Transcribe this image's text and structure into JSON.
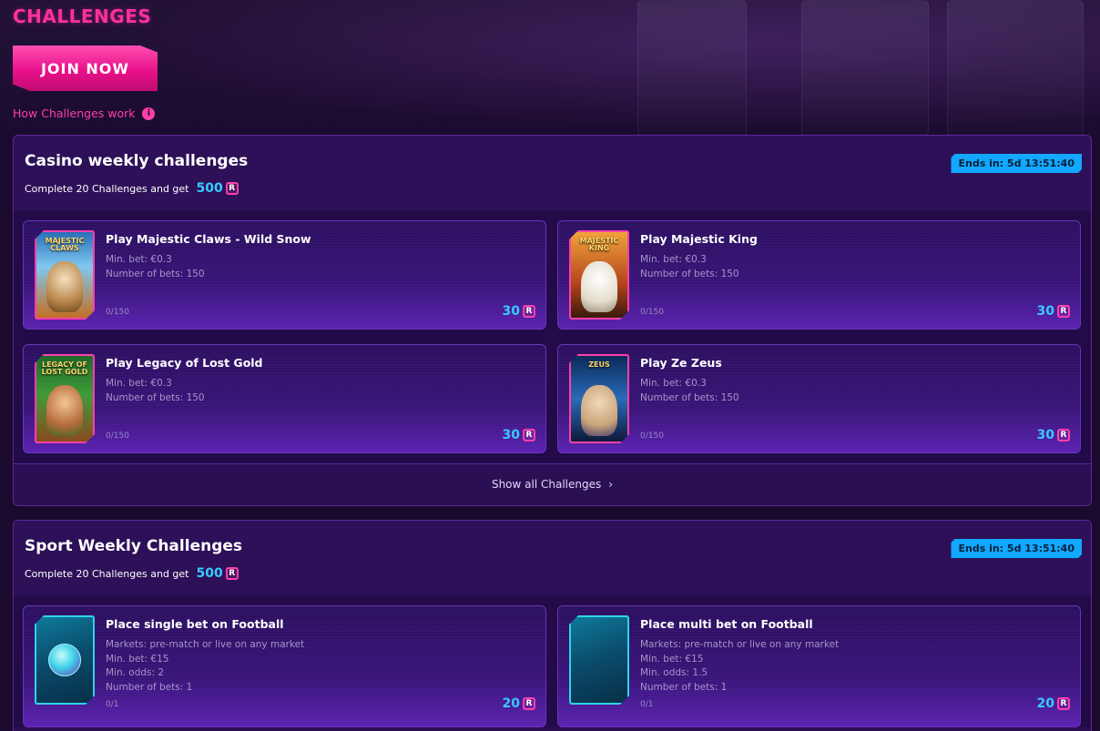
{
  "page": {
    "title": "CHALLENGES",
    "join_label": "JOIN NOW",
    "how_label": "How Challenges work"
  },
  "colors": {
    "accent": "#ff2fa0",
    "reward": "#39c9ff",
    "badge": "#12a8ff",
    "panel": "#2a0f55"
  },
  "casino": {
    "title": "Casino weekly challenges",
    "subtitle": "Complete 20 Challenges and get",
    "reward": "500",
    "ends": "Ends in: 5d 13:51:40",
    "show_all": "Show all Challenges",
    "cards": [
      {
        "title": "Play Majestic Claws - Wild Snow",
        "min_bet": "Min. bet: €0.3",
        "bets": "Number of bets: 150",
        "progress": "0/150",
        "reward": "30",
        "thumb": "MAJESTIC CLAWS"
      },
      {
        "title": "Play Majestic King",
        "min_bet": "Min. bet: €0.3",
        "bets": "Number of bets: 150",
        "progress": "0/150",
        "reward": "30",
        "thumb": "MAJESTIC KING"
      },
      {
        "title": "Play Legacy of Lost Gold",
        "min_bet": "Min. bet: €0.3",
        "bets": "Number of bets: 150",
        "progress": "0/150",
        "reward": "30",
        "thumb": "LEGACY OF LOST GOLD"
      },
      {
        "title": "Play Ze Zeus",
        "min_bet": "Min. bet: €0.3",
        "bets": "Number of bets: 150",
        "progress": "0/150",
        "reward": "30",
        "thumb": "ZEUS"
      }
    ]
  },
  "sport": {
    "title": "Sport Weekly Challenges",
    "subtitle": "Complete 20 Challenges and get",
    "reward": "500",
    "ends": "Ends in: 5d 13:51:40",
    "cards": [
      {
        "title": "Place single bet on Football",
        "markets": "Markets: pre-match or live on any market",
        "min_bet": "Min. bet: €15",
        "odds": "Min. odds: 2",
        "bets": "Number of bets: 1",
        "progress": "0/1",
        "reward": "20"
      },
      {
        "title": "Place multi bet on Football",
        "markets": "Markets: pre-match or live on any market",
        "min_bet": "Min. bet: €15",
        "odds": "Min. odds: 1.5",
        "bets": "Number of bets: 1",
        "progress": "0/1",
        "reward": "20"
      }
    ]
  }
}
